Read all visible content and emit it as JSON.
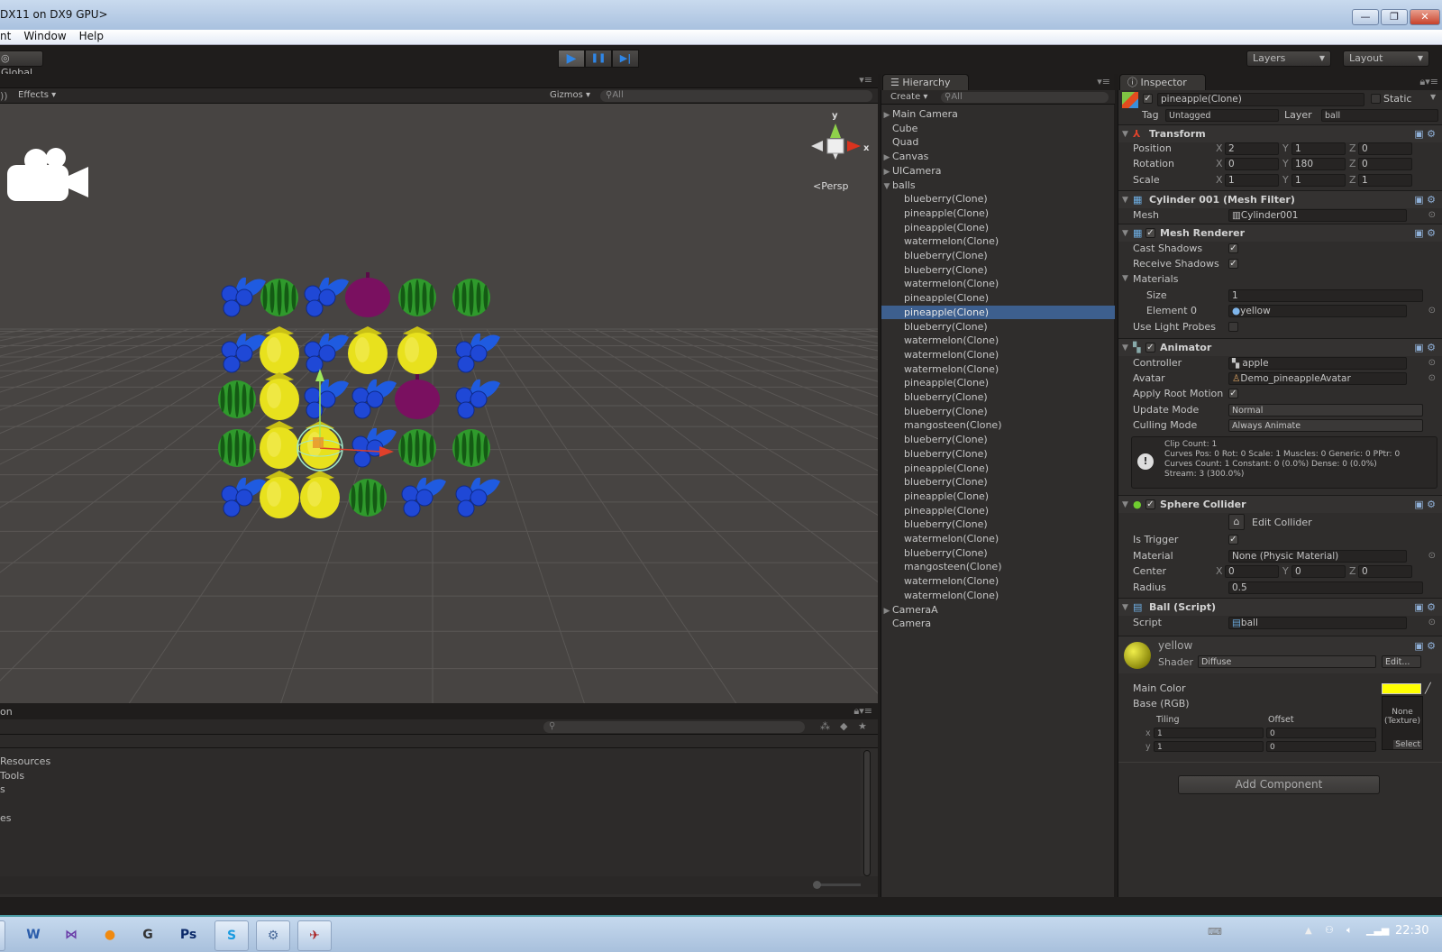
{
  "window": {
    "title": "DX11 on DX9 GPU>",
    "minimize": "—",
    "restore": "❐",
    "close": "✕"
  },
  "menu": {
    "items": [
      "nt",
      "Window",
      "Help"
    ]
  },
  "toolbar": {
    "global_label": "Global",
    "play_icon": "▶",
    "pause_icon": "❚❚",
    "step_icon": "▶|",
    "layers_label": "Layers",
    "layout_label": "Layout"
  },
  "scene": {
    "effects_label": "Effects",
    "gizmos_label": "Gizmos",
    "search_placeholder": "All",
    "persp_label": "Persp",
    "gizmo_axes": {
      "y": "y",
      "x": "x"
    },
    "grid": [
      [
        "blueberry",
        "watermelon",
        "blueberry",
        "mangosteen",
        "watermelon",
        "watermelon"
      ],
      [
        "blueberry",
        "pineapple",
        "blueberry",
        "pineapple",
        "pineapple",
        "blueberry"
      ],
      [
        "watermelon",
        "pineapple",
        "blueberry",
        "blueberry",
        "mangosteen",
        "blueberry"
      ],
      [
        "watermelon",
        "pineapple",
        "pineapple",
        "blueberry",
        "watermelon",
        "watermelon"
      ],
      [
        "blueberry",
        "pineapple",
        "pineapple",
        "watermelon",
        "blueberry",
        "blueberry"
      ]
    ],
    "colors": {
      "watermelon": "#2f9a2c",
      "pineapple": "#e8e11d",
      "blueberry": "#1f48d6",
      "mangosteen": "#7a1060"
    }
  },
  "hierarchy": {
    "tab_label": "Hierarchy",
    "create_label": "Create",
    "search_placeholder": "All",
    "items": [
      {
        "label": "Main Camera",
        "depth": 0,
        "expand": "collapsed"
      },
      {
        "label": "Cube",
        "depth": 0,
        "expand": "none"
      },
      {
        "label": "Quad",
        "depth": 0,
        "expand": "none"
      },
      {
        "label": "Canvas",
        "depth": 0,
        "expand": "collapsed"
      },
      {
        "label": "UICamera",
        "depth": 0,
        "expand": "collapsed"
      },
      {
        "label": "balls",
        "depth": 0,
        "expand": "expanded"
      },
      {
        "label": "blueberry(Clone)",
        "depth": 1
      },
      {
        "label": "pineapple(Clone)",
        "depth": 1
      },
      {
        "label": "pineapple(Clone)",
        "depth": 1
      },
      {
        "label": "watermelon(Clone)",
        "depth": 1
      },
      {
        "label": "blueberry(Clone)",
        "depth": 1
      },
      {
        "label": "blueberry(Clone)",
        "depth": 1
      },
      {
        "label": "watermelon(Clone)",
        "depth": 1
      },
      {
        "label": "pineapple(Clone)",
        "depth": 1
      },
      {
        "label": "pineapple(Clone)",
        "depth": 1,
        "selected": true
      },
      {
        "label": "blueberry(Clone)",
        "depth": 1
      },
      {
        "label": "watermelon(Clone)",
        "depth": 1
      },
      {
        "label": "watermelon(Clone)",
        "depth": 1
      },
      {
        "label": "watermelon(Clone)",
        "depth": 1
      },
      {
        "label": "pineapple(Clone)",
        "depth": 1
      },
      {
        "label": "blueberry(Clone)",
        "depth": 1
      },
      {
        "label": "blueberry(Clone)",
        "depth": 1
      },
      {
        "label": "mangosteen(Clone)",
        "depth": 1
      },
      {
        "label": "blueberry(Clone)",
        "depth": 1
      },
      {
        "label": "blueberry(Clone)",
        "depth": 1
      },
      {
        "label": "pineapple(Clone)",
        "depth": 1
      },
      {
        "label": "blueberry(Clone)",
        "depth": 1
      },
      {
        "label": "pineapple(Clone)",
        "depth": 1
      },
      {
        "label": "pineapple(Clone)",
        "depth": 1
      },
      {
        "label": "blueberry(Clone)",
        "depth": 1
      },
      {
        "label": "watermelon(Clone)",
        "depth": 1
      },
      {
        "label": "blueberry(Clone)",
        "depth": 1
      },
      {
        "label": "mangosteen(Clone)",
        "depth": 1
      },
      {
        "label": "watermelon(Clone)",
        "depth": 1
      },
      {
        "label": "watermelon(Clone)",
        "depth": 1
      },
      {
        "label": "CameraA",
        "depth": 0,
        "expand": "collapsed"
      },
      {
        "label": "Camera",
        "depth": 0,
        "expand": "none"
      }
    ]
  },
  "inspector": {
    "tab_label": "Inspector",
    "object_name": "pineapple(Clone)",
    "static_label": "Static",
    "tag_label": "Tag",
    "tag_value": "Untagged",
    "layer_label": "Layer",
    "layer_value": "ball",
    "transform": {
      "title": "Transform",
      "position_label": "Position",
      "rotation_label": "Rotation",
      "scale_label": "Scale",
      "position": [
        "2",
        "1",
        "0"
      ],
      "rotation": [
        "0",
        "180",
        "0"
      ],
      "scale": [
        "1",
        "1",
        "1"
      ]
    },
    "mesh_filter": {
      "title": "Cylinder 001 (Mesh Filter)",
      "mesh_label": "Mesh",
      "mesh_value": "Cylinder001"
    },
    "mesh_renderer": {
      "title": "Mesh Renderer",
      "cast_label": "Cast Shadows",
      "receive_label": "Receive Shadows",
      "materials_label": "Materials",
      "size_label": "Size",
      "size_value": "1",
      "element_label": "Element 0",
      "element_value": "yellow",
      "probes_label": "Use Light Probes",
      "cast": true,
      "receive": true,
      "probes": false
    },
    "animator": {
      "title": "Animator",
      "controller_label": "Controller",
      "controller_value": "apple",
      "avatar_label": "Avatar",
      "avatar_value": "Demo_pineappleAvatar",
      "root_label": "Apply Root Motion",
      "root": true,
      "update_label": "Update Mode",
      "update_value": "Normal",
      "culling_label": "Culling Mode",
      "culling_value": "Always Animate",
      "info": [
        "Clip Count: 1",
        "Curves Pos: 0 Rot: 0 Scale: 1 Muscles: 0 Generic: 0 PPtr: 0",
        "Curves Count: 1 Constant: 0 (0.0%) Dense: 0 (0.0%)",
        "Stream: 3 (300.0%)"
      ]
    },
    "sphere_collider": {
      "title": "Sphere Collider",
      "edit_label": "Edit Collider",
      "trigger_label": "Is Trigger",
      "trigger": true,
      "material_label": "Material",
      "material_value": "None (Physic Material)",
      "center_label": "Center",
      "center": [
        "0",
        "0",
        "0"
      ],
      "radius_label": "Radius",
      "radius_value": "0.5"
    },
    "script": {
      "title": "Ball (Script)",
      "script_label": "Script",
      "script_value": "ball"
    },
    "material": {
      "name": "yellow",
      "shader_label": "Shader",
      "shader_value": "Diffuse",
      "edit_label": "Edit...",
      "main_color_label": "Main Color",
      "main_color": "#ffff00",
      "base_label": "Base (RGB)",
      "tiling_label": "Tiling",
      "offset_label": "Offset",
      "x_label": "x",
      "y_label": "y",
      "tiling": [
        "1",
        "1"
      ],
      "offset": [
        "0",
        "0"
      ],
      "texture_label": "None\n(Texture)",
      "select_label": "Select"
    },
    "add_component_label": "Add Component"
  },
  "project": {
    "tab_label": "on",
    "items": [
      "Resources",
      "Tools",
      "s",
      "",
      "es"
    ]
  },
  "taskbar": {
    "apps": [
      "W",
      "⋈",
      "●",
      "G",
      "Ps",
      "S",
      "⚙",
      "✈"
    ],
    "clock": "22:30"
  }
}
